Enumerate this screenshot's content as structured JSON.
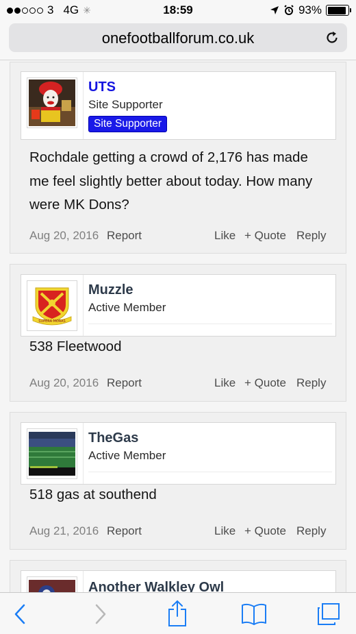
{
  "status_bar": {
    "carrier": "3",
    "network": "4G",
    "time": "18:59",
    "battery_text": "93%",
    "battery_level": 0.93
  },
  "browser": {
    "url": "onefootballforum.co.uk"
  },
  "posts": [
    {
      "username": "UTS",
      "user_title": "Site Supporter",
      "banner": "Site Supporter",
      "message": "Rochdale getting a crowd of 2,176 has made me feel slightly better about today. How many were MK Dons?",
      "date": "Aug 20, 2016",
      "report": "Report",
      "like": "Like",
      "quote": "+ Quote",
      "reply": "Reply"
    },
    {
      "username": "Muzzle",
      "user_title": "Active Member",
      "message": "538 Fleetwood",
      "date": "Aug 20, 2016",
      "report": "Report",
      "like": "Like",
      "quote": "+ Quote",
      "reply": "Reply"
    },
    {
      "username": "TheGas",
      "user_title": "Active Member",
      "message": "518 gas at southend",
      "date": "Aug 21, 2016",
      "report": "Report",
      "like": "Like",
      "quote": "+ Quote",
      "reply": "Reply"
    },
    {
      "username": "Another Walkley Owl"
    }
  ],
  "colors": {
    "supporter_name": "#1515e0",
    "member_name": "#2d3a4a",
    "banner_bg": "#1a1ae8",
    "ios_blue": "#1a7df5"
  },
  "icons": [
    "back-icon",
    "forward-icon",
    "share-icon",
    "bookmarks-icon",
    "tabs-icon",
    "reload-icon",
    "location-icon",
    "alarm-icon"
  ]
}
